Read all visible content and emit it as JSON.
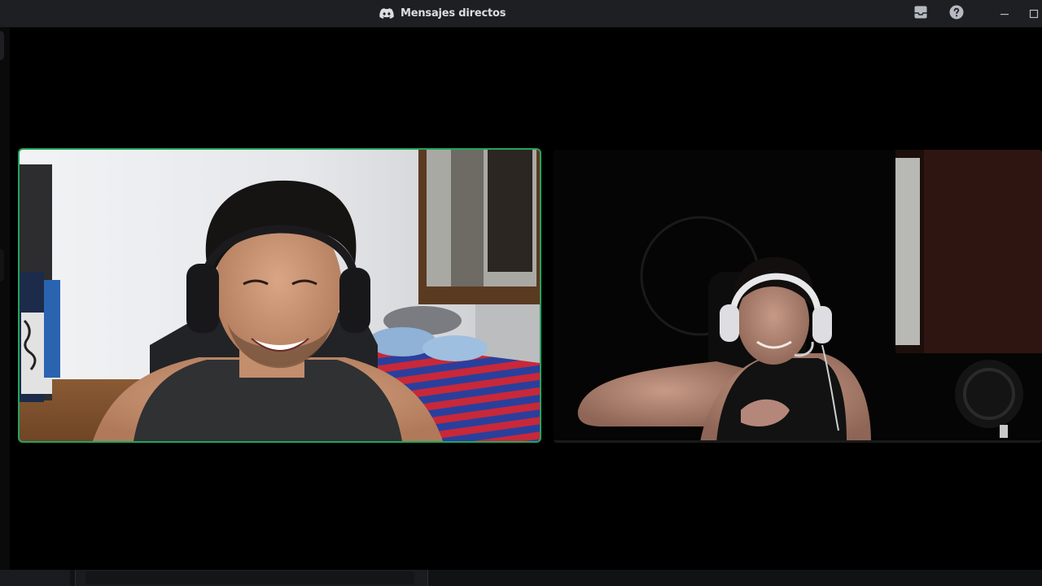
{
  "window": {
    "title": "Mensajes directos",
    "title_icon": "discord-logo-icon"
  },
  "titlebar_buttons": [
    {
      "name": "inbox-icon"
    },
    {
      "name": "help-icon"
    },
    {
      "name": "minimize-icon"
    },
    {
      "name": "maximize-icon"
    }
  ],
  "call": {
    "participants": [
      {
        "tile": "left",
        "speaking": true,
        "scene": "bright room with bed and window, person wearing black headphones smiling"
      },
      {
        "tile": "right",
        "speaking": false,
        "scene": "dark room, person wearing white headset leaning on arm"
      }
    ]
  },
  "colors": {
    "titlebar_bg": "#1e1f22",
    "title_text": "#dbdee1",
    "speaking_ring": "#23a55a",
    "stage_bg": "#000000"
  }
}
